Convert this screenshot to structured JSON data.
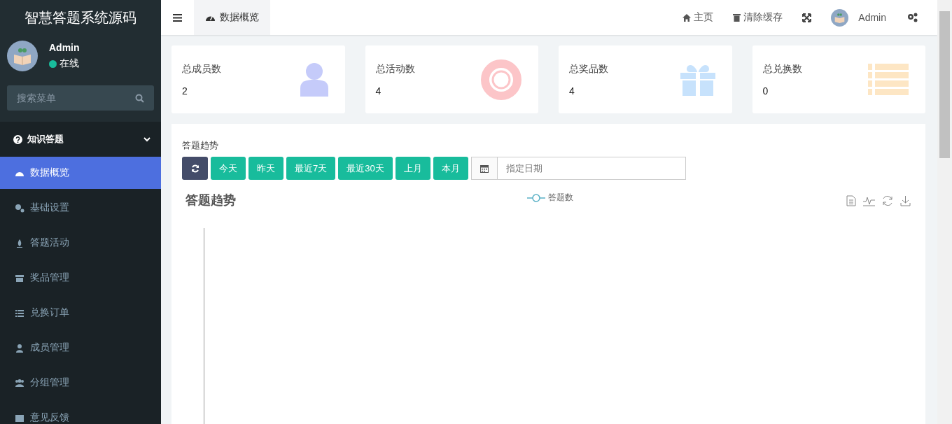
{
  "sidebar": {
    "logo": "智慧答题系统源码",
    "user": {
      "name": "Admin",
      "status": "在线",
      "online": true
    },
    "search": {
      "placeholder": "搜索菜单"
    },
    "group": {
      "label": "知识答题",
      "expanded": true,
      "items": [
        {
          "label": "数据概览",
          "kind": "dashboard",
          "selected": true
        },
        {
          "label": "基础设置",
          "kind": "gears",
          "selected": false
        },
        {
          "label": "答题活动",
          "kind": "flame",
          "selected": false
        },
        {
          "label": "奖品管理",
          "kind": "archive",
          "selected": false
        },
        {
          "label": "兑换订单",
          "kind": "list",
          "selected": false
        },
        {
          "label": "成员管理",
          "kind": "user",
          "selected": false
        },
        {
          "label": "分组管理",
          "kind": "users",
          "selected": false
        },
        {
          "label": "意见反馈",
          "kind": "doc",
          "selected": false
        }
      ]
    }
  },
  "topbar": {
    "tabs": [
      {
        "label": "数据概览",
        "selected": true
      }
    ],
    "links": [
      {
        "label": "主页",
        "kind": "home"
      },
      {
        "label": "清除缓存",
        "kind": "trash"
      }
    ],
    "user": "Admin"
  },
  "stats": [
    {
      "label": "总成员数",
      "value": "2",
      "kind": "user",
      "color": "#c5cbfa"
    },
    {
      "label": "总活动数",
      "value": "4",
      "kind": "ring",
      "color": "#fcc5c8"
    },
    {
      "label": "总奖品数",
      "value": "4",
      "kind": "gift",
      "color": "#c7e2fc"
    },
    {
      "label": "总兑换数",
      "value": "0",
      "kind": "list",
      "color": "#fde6c4"
    }
  ],
  "trend": {
    "heading": "答题趋势",
    "buttons": [
      "今天",
      "昨天",
      "最近7天",
      "最近30天",
      "上月",
      "本月"
    ],
    "date": {
      "placeholder": "指定日期"
    },
    "chart": {
      "title": "答题趋势",
      "legend": "答题数"
    }
  }
}
